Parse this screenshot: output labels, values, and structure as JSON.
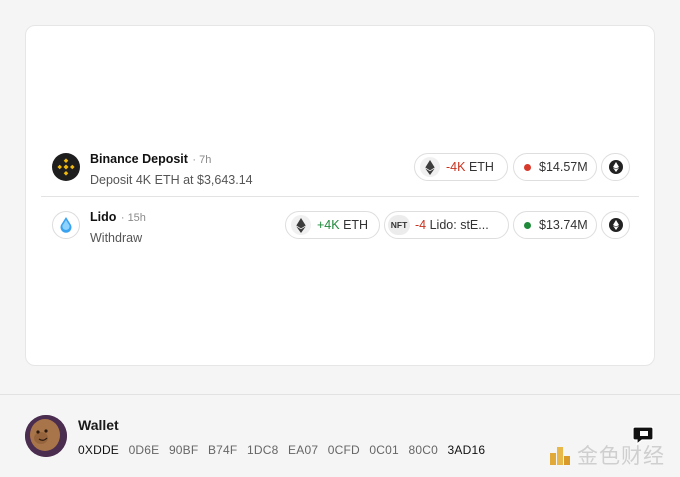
{
  "transactions": [
    {
      "name": "Binance Deposit",
      "time": "· 7h",
      "description": "Deposit 4K ETH at $3,643.14",
      "icon": "binance-logo-icon",
      "token_change": "-4K",
      "token_symbol": "ETH",
      "value": "$14.57M",
      "value_dot_color": "#d73a2a"
    },
    {
      "name": "Lido",
      "time": "· 15h",
      "description": "Withdraw",
      "icon": "lido-logo-icon",
      "token_change": "+4K",
      "token_symbol": "ETH",
      "nft_badge": "NFT",
      "nft_change": "-4",
      "nft_name": "Lido: stE...",
      "value": "$13.74M",
      "value_dot_color": "#1f8a3a"
    }
  ],
  "wallet": {
    "label": "Wallet",
    "address_groups": [
      "0XDDE",
      "0D6E",
      "90BF",
      "B74F",
      "1DC8",
      "EA07",
      "0CFD",
      "0C01",
      "80C0",
      "3AD16"
    ]
  },
  "watermark": {
    "text": "金色财经"
  },
  "colors": {
    "negative": "#c8321e",
    "positive": "#1f8a3a",
    "binance_yellow": "#f0b90b"
  }
}
